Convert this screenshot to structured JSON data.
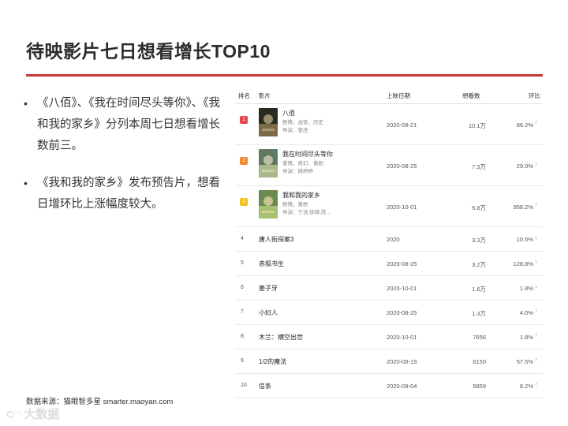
{
  "title": "待映影片七日想看增长TOP10",
  "bullets": [
    "《八佰》、《我在时间尽头等你》、《我和我的家乡》分列本周七日想看增长数前三。",
    "《我和我的家乡》发布预告片，想看日增环比上涨幅度较大。"
  ],
  "source": "数据来源：猫眼智多星    smarter.maoyan.com",
  "watermark": "大数据",
  "colors": {
    "accent": "#c9353a",
    "up": "#d43d3d",
    "down": "#2f9e4a",
    "rank1": "#e0474c",
    "rank2": "#f08a2d",
    "rank3": "#f4c21c"
  },
  "table": {
    "headers": {
      "rank": "排名",
      "film": "影片",
      "date": "上映日期",
      "count": "想看数",
      "ratio": "环比"
    },
    "rows": [
      {
        "rank": "1",
        "name": "八佰",
        "genre": "剧情、战争、历史",
        "director": "导演：管虎",
        "cast": "",
        "date": "2020-08-21",
        "count": "10.1万",
        "ratio": "86.2%",
        "trend": "up",
        "trend_icon": "arrow-up-icon"
      },
      {
        "rank": "2",
        "name": "我在时间尽头等你",
        "genre": "爱情、奇幻、喜剧",
        "director": "导演：姚婷婷",
        "cast": "",
        "date": "2020-08-25",
        "count": "7.3万",
        "ratio": "29.0%",
        "trend": "down",
        "trend_icon": "arrow-down-icon"
      },
      {
        "rank": "3",
        "name": "我和我的家乡",
        "genre": "剧情、喜剧",
        "director": "导演：宁浩,徐峥,陈...",
        "cast": "",
        "date": "2020-10-01",
        "count": "5.8万",
        "ratio": "958.2%",
        "trend": "up",
        "trend_icon": "arrow-up-icon"
      },
      {
        "rank": "4",
        "name": "唐人街探案3",
        "date": "2020",
        "count": "3.3万",
        "ratio": "10.5%",
        "trend": "down",
        "trend_icon": "arrow-down-icon"
      },
      {
        "rank": "5",
        "name": "赤狐书生",
        "date": "2020-08-25",
        "count": "3.2万",
        "ratio": "128.8%",
        "trend": "up",
        "trend_icon": "arrow-up-icon"
      },
      {
        "rank": "6",
        "name": "姜子牙",
        "date": "2020-10-01",
        "count": "1.6万",
        "ratio": "1.8%",
        "trend": "down",
        "trend_icon": "arrow-down-icon"
      },
      {
        "rank": "7",
        "name": "小妇人",
        "date": "2020-08-25",
        "count": "1.3万",
        "ratio": "4.0%",
        "trend": "up",
        "trend_icon": "arrow-up-icon"
      },
      {
        "rank": "8",
        "name": "木兰：横空出世",
        "date": "2020-10-01",
        "count": "7656",
        "ratio": "1.8%",
        "trend": "up",
        "trend_icon": "arrow-up-icon"
      },
      {
        "rank": "9",
        "name": "1/2的魔法",
        "date": "2020-08-19",
        "count": "6150",
        "ratio": "57.5%",
        "trend": "up",
        "trend_icon": "arrow-up-icon"
      },
      {
        "rank": "10",
        "name": "信条",
        "date": "2020-09-04",
        "count": "5859",
        "ratio": "8.2%",
        "trend": "up",
        "trend_icon": "arrow-up-icon"
      }
    ]
  }
}
